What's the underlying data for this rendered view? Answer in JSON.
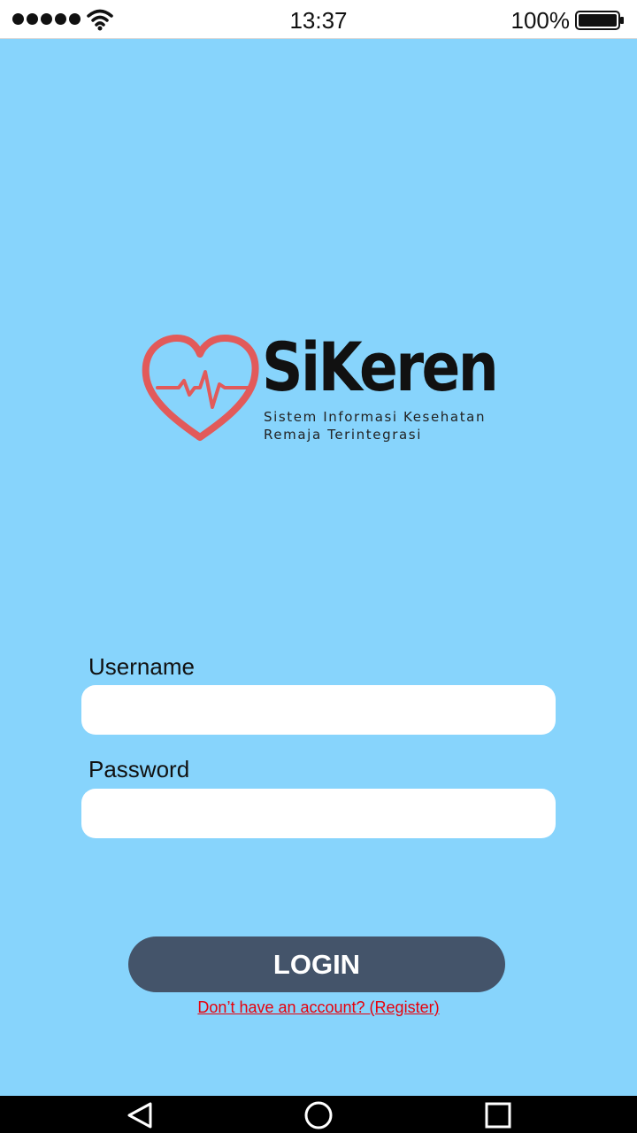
{
  "status_bar": {
    "time": "13:37",
    "battery_percent": "100%",
    "signal_icon": "signal-dots-icon",
    "wifi_icon": "wifi-icon",
    "battery_icon": "battery-full-icon"
  },
  "logo": {
    "name": "SiKeren",
    "tagline_line1": "Sistem Informasi Kesehatan",
    "tagline_line2": "Remaja Terintegrasi",
    "icon": "heart-pulse-icon",
    "heart_color": "#e25a5a"
  },
  "form": {
    "username_label": "Username",
    "username_value": "",
    "password_label": "Password",
    "password_value": ""
  },
  "actions": {
    "login_label": "LOGIN",
    "register_link": "Don’t have an account? (Register)"
  },
  "nav_bar": {
    "back_icon": "back-triangle-icon",
    "home_icon": "home-circle-icon",
    "recent_icon": "recent-square-icon"
  },
  "colors": {
    "background": "#87d4fc",
    "button": "#44546a",
    "link": "#e8000b"
  }
}
